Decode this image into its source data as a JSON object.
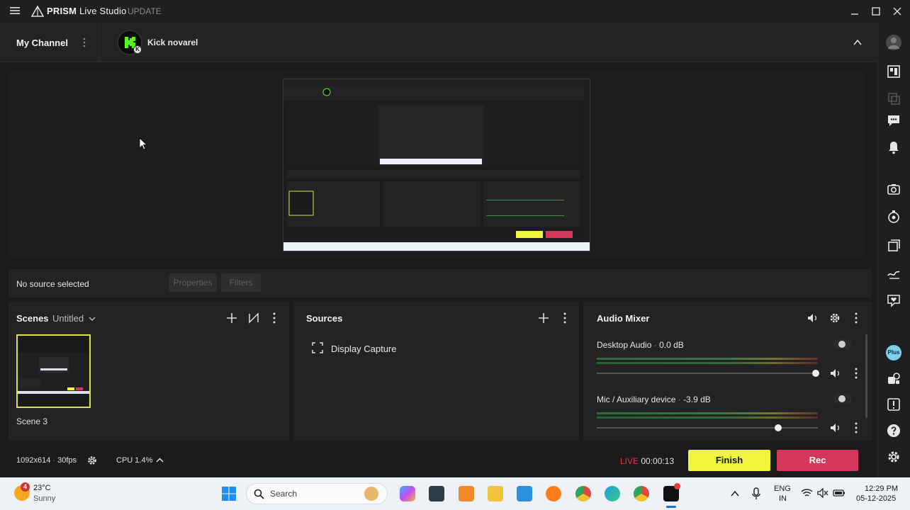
{
  "app": {
    "brand": "PRISM",
    "brand_suffix": "Live Studio",
    "update_label": "UPDATE"
  },
  "channel": {
    "my_channel": "My Channel",
    "account_name": "Kick novarel"
  },
  "source_bar": {
    "status": "No source selected",
    "properties_label": "Properties",
    "filters_label": "Filters"
  },
  "scenes": {
    "title": "Scenes",
    "collection": "Untitled",
    "items": [
      {
        "label": "Scene 3"
      }
    ]
  },
  "sources": {
    "title": "Sources",
    "items": [
      {
        "label": "Display Capture"
      }
    ]
  },
  "audio_mixer": {
    "title": "Audio Mixer",
    "channels": [
      {
        "name": "Desktop Audio",
        "level": "0.0 dB",
        "volume": 0.99
      },
      {
        "name": "Mic / Auxiliary device",
        "level": "-3.9 dB",
        "volume": 0.82
      }
    ]
  },
  "status": {
    "resolution": "1092x614",
    "fps": "30fps",
    "cpu": "CPU 1.4%",
    "live_label": "LIVE",
    "live_time": "00:00:13",
    "finish_label": "Finish",
    "rec_label": "Rec"
  },
  "taskbar": {
    "weather_temp": "23°C",
    "weather_desc": "Sunny",
    "weather_badge": "4",
    "search_placeholder": "Search",
    "lang_top": "ENG",
    "lang_bottom": "IN",
    "time": "12:29 PM",
    "date": "05-12-2025"
  },
  "colors": {
    "accent_yellow": "#eef53a",
    "rec_red": "#d4375a",
    "live_red": "#e8334a",
    "kick_green": "#53fc18"
  }
}
